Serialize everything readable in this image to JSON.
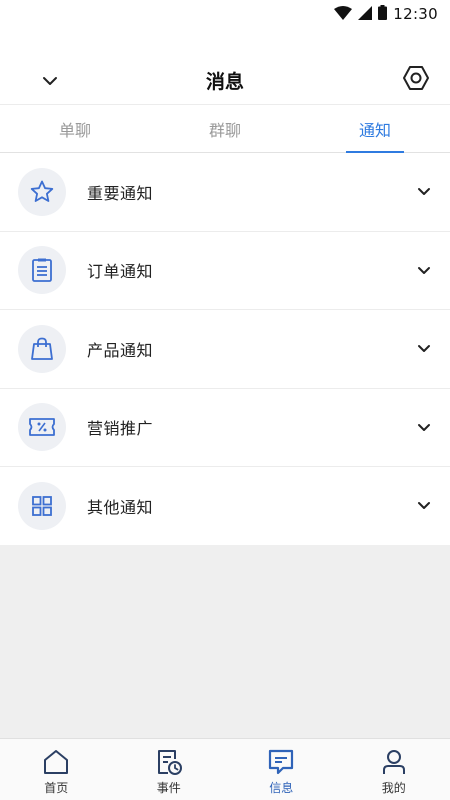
{
  "status_bar": {
    "time": "12:30"
  },
  "header": {
    "title": "消息",
    "left_icon": "chevron-down-icon",
    "right_icon": "settings-hexagon-icon"
  },
  "tabs": [
    {
      "label": "单聊",
      "active": false
    },
    {
      "label": "群聊",
      "active": false
    },
    {
      "label": "通知",
      "active": true
    }
  ],
  "notifications": [
    {
      "label": "重要通知",
      "icon": "star-icon"
    },
    {
      "label": "订单通知",
      "icon": "clipboard-list-icon"
    },
    {
      "label": "产品通知",
      "icon": "shopping-bag-icon"
    },
    {
      "label": "营销推广",
      "icon": "coupon-icon"
    },
    {
      "label": "其他通知",
      "icon": "grid-icon"
    }
  ],
  "bottom_nav": [
    {
      "label": "首页",
      "icon": "home-icon",
      "active": false
    },
    {
      "label": "事件",
      "icon": "event-clock-icon",
      "active": false
    },
    {
      "label": "信息",
      "icon": "message-icon",
      "active": true
    },
    {
      "label": "我的",
      "icon": "user-icon",
      "active": false
    }
  ],
  "colors": {
    "accent": "#2f7be0",
    "icon_blue": "#3d6fd1",
    "nav_active": "#2f63b8"
  }
}
